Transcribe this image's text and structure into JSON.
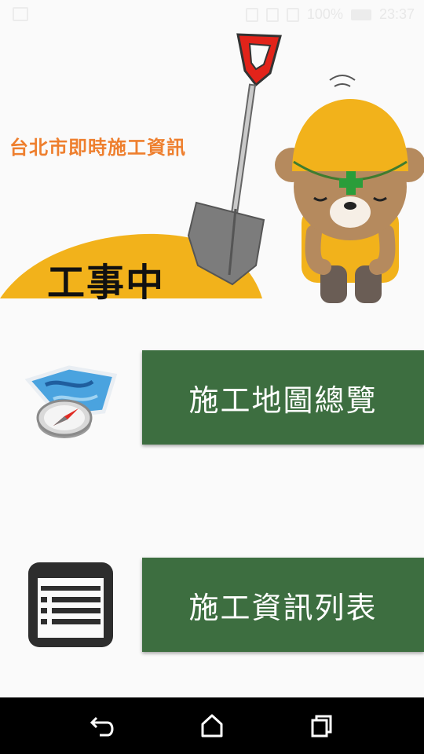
{
  "status_bar": {
    "battery": "100%",
    "time": "23:37"
  },
  "hero": {
    "title": "台北市即時施工資訊",
    "subtitle": "工事中"
  },
  "menu": [
    {
      "label": "施工地圖總覽",
      "icon": "map-compass-icon"
    },
    {
      "label": "施工資訊列表",
      "icon": "list-document-icon"
    }
  ],
  "nav": {
    "back": "back-icon",
    "home": "home-icon",
    "recent": "recent-apps-icon"
  },
  "colors": {
    "button_green": "#3d6e40",
    "title_orange": "#ee7f2e",
    "bear_yellow": "#f2b21b",
    "background": "#fafafa"
  }
}
